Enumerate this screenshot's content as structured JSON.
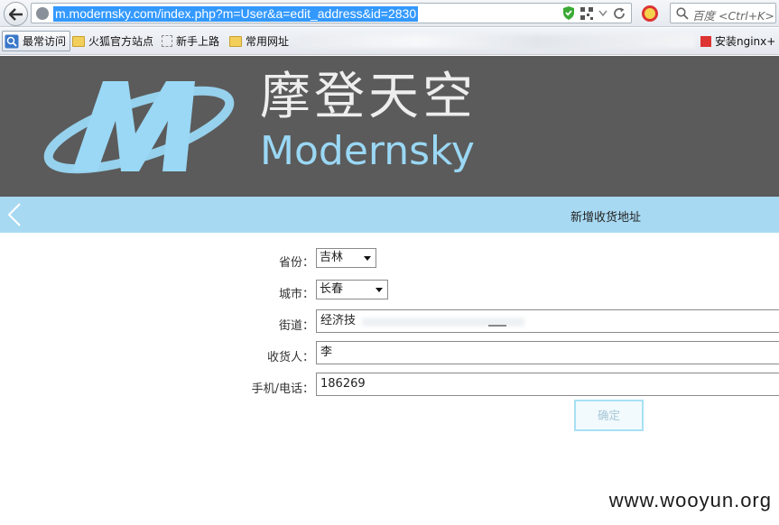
{
  "browser": {
    "url": "m.modernsky.com/index.php?m=User&a=edit_address&id=2830",
    "search_placeholder": "百度 <Ctrl+K>",
    "bookmarks": [
      {
        "label": "最常访问",
        "icon": "magnifier-icon"
      },
      {
        "label": "火狐官方站点",
        "icon": "folder-icon"
      },
      {
        "label": "新手上路",
        "icon": "page-icon"
      },
      {
        "label": "常用网址",
        "icon": "folder-icon"
      }
    ],
    "last_bookmark": "安装nginx+"
  },
  "header": {
    "brand_cn": "摩登天空",
    "brand_en": "Modernsky",
    "logo_letter": "M"
  },
  "nav": {
    "title": "新增收货地址"
  },
  "form": {
    "province_label": "省份：",
    "province_value": "吉林",
    "city_label": "城市：",
    "city_value": "长春",
    "street_label": "街道：",
    "street_value": "经济技",
    "receiver_label": "收货人：",
    "receiver_value": "李",
    "phone_label": "手机/电话：",
    "phone_value": "186269",
    "confirm_label": "确定"
  },
  "watermark": "www.wooyun.org",
  "colors": {
    "header_bg": "#5b5b5b",
    "navbar_bg": "#a8d9f2",
    "brand_blue": "#9ad8f5"
  }
}
